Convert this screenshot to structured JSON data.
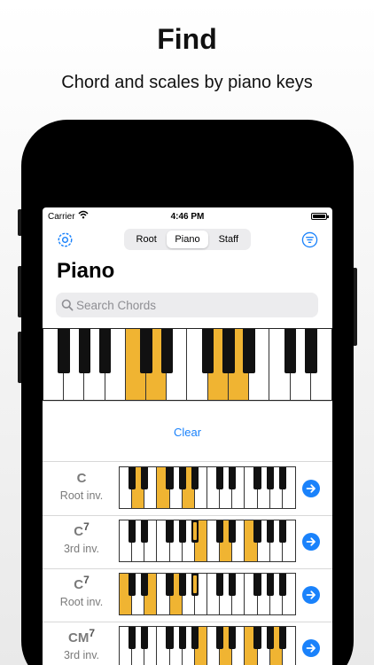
{
  "marketing": {
    "headline": "Find",
    "subline": "Chord and scales by piano keys"
  },
  "status_bar": {
    "carrier": "Carrier",
    "time": "4:46 PM"
  },
  "nav": {
    "tabs": [
      {
        "label": "Root"
      },
      {
        "label": "Piano",
        "active": true
      },
      {
        "label": "Staff"
      }
    ]
  },
  "page": {
    "title": "Piano"
  },
  "search": {
    "placeholder": "Search Chords",
    "value": ""
  },
  "colors": {
    "accent": "#1a82fb",
    "highlight_key": "#f0b432",
    "phone_body": "#000000"
  },
  "big_piano": {
    "white_key_count": 14,
    "highlighted_white_keys": [
      4,
      5,
      8,
      9
    ],
    "start_note": "F"
  },
  "clear_label": "Clear",
  "chords": [
    {
      "name": "C",
      "sup": "",
      "inversion": "Root inv.",
      "highlighted_white_keys": [
        1,
        3,
        5
      ]
    },
    {
      "name": "C",
      "sup": "7",
      "inversion": "3rd inv.",
      "highlighted_white_keys": [
        6,
        8,
        10
      ],
      "highlighted_black_keys": [
        4
      ]
    },
    {
      "name": "C",
      "sup": "7",
      "inversion": "Root inv.",
      "highlighted_white_keys": [
        0,
        2,
        4
      ],
      "highlighted_black_keys": [
        4
      ]
    },
    {
      "name": "CM",
      "sup": "7",
      "inversion": "3rd inv.",
      "highlighted_white_keys": [
        6,
        8,
        10,
        12
      ]
    }
  ]
}
